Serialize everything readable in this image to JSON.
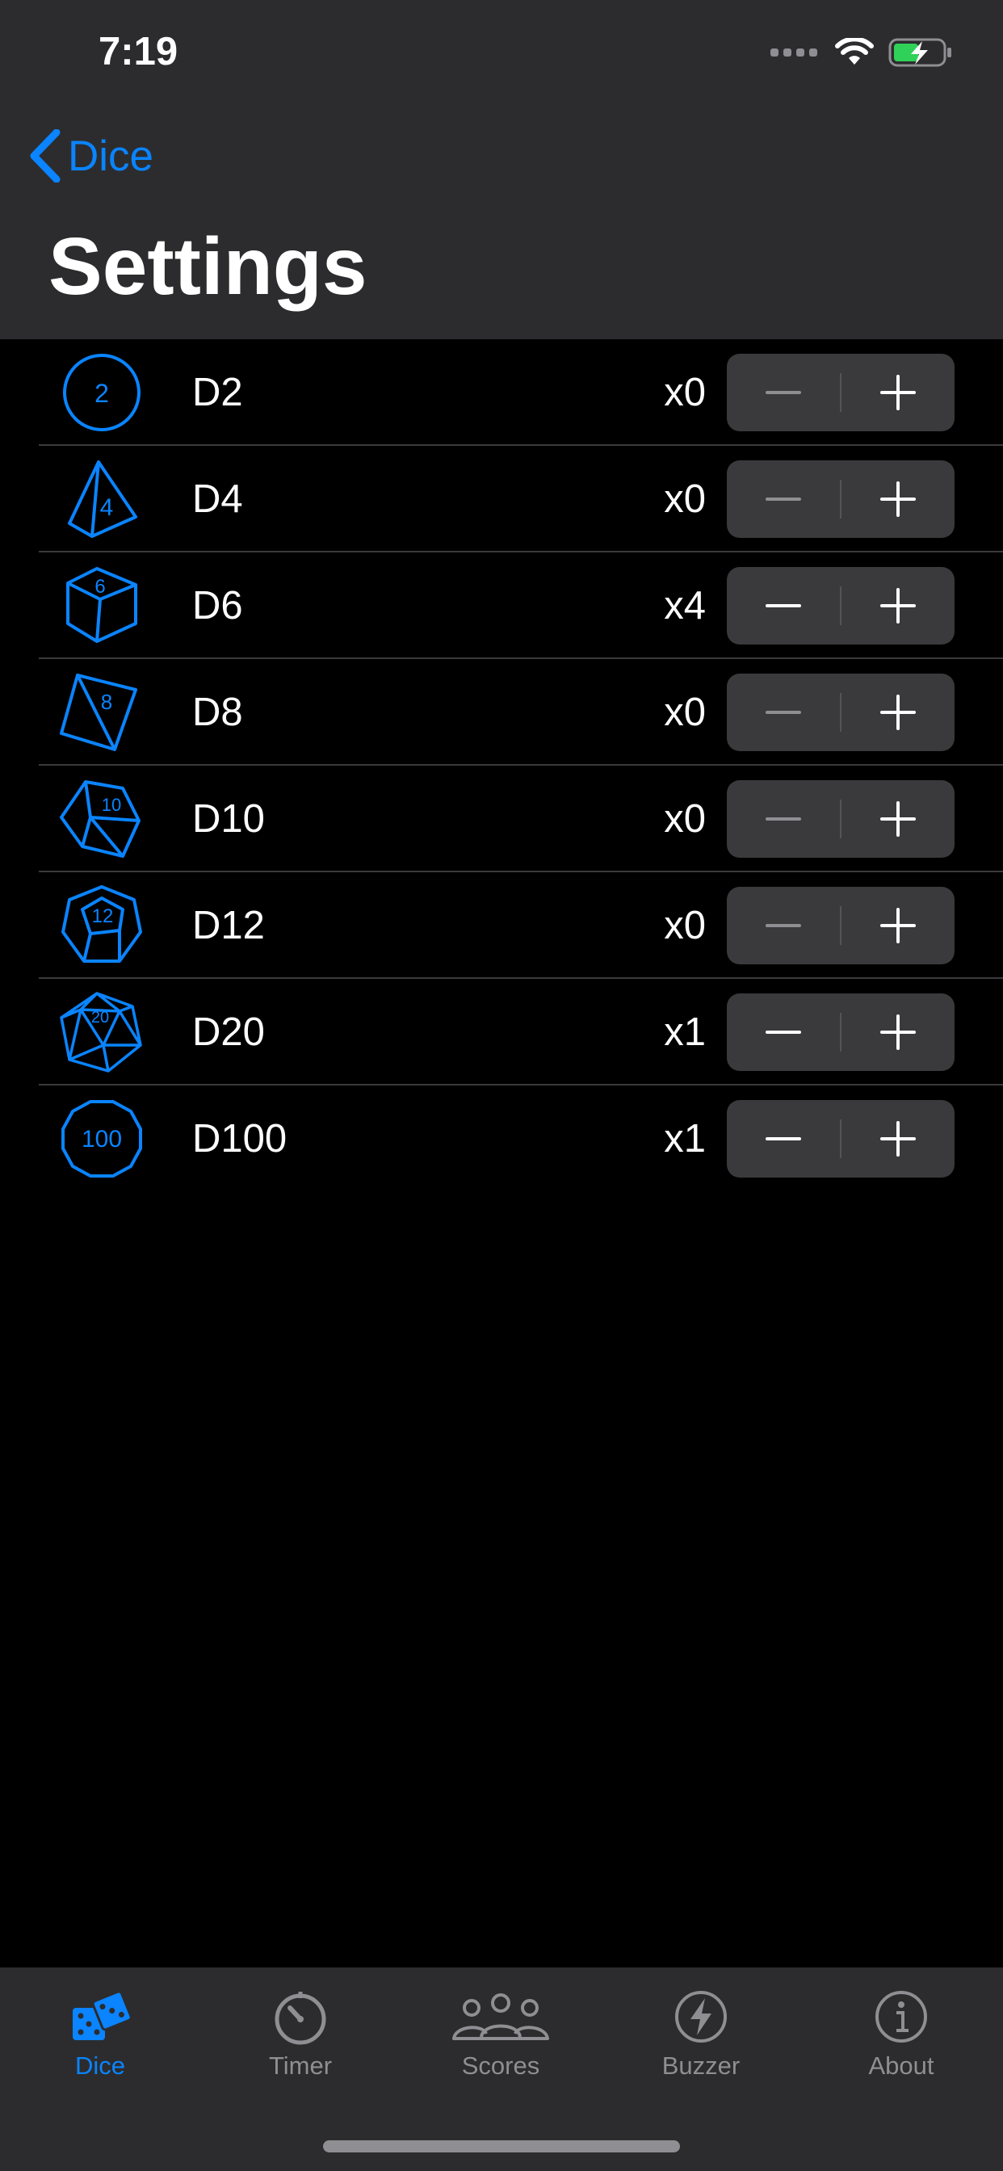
{
  "status": {
    "time": "7:19"
  },
  "nav": {
    "back_label": "Dice",
    "title": "Settings"
  },
  "dice": [
    {
      "label": "D2",
      "count": "x0",
      "icon": "d2-circle-icon",
      "face": "2",
      "can_decrement": false
    },
    {
      "label": "D4",
      "count": "x0",
      "icon": "d4-tetrahedron-icon",
      "face": "4",
      "can_decrement": false
    },
    {
      "label": "D6",
      "count": "x4",
      "icon": "d6-cube-icon",
      "face": "6",
      "can_decrement": true
    },
    {
      "label": "D8",
      "count": "x0",
      "icon": "d8-octahedron-icon",
      "face": "8",
      "can_decrement": false
    },
    {
      "label": "D10",
      "count": "x0",
      "icon": "d10-icon",
      "face": "10",
      "can_decrement": false
    },
    {
      "label": "D12",
      "count": "x0",
      "icon": "d12-dodecahedron-icon",
      "face": "12",
      "can_decrement": false
    },
    {
      "label": "D20",
      "count": "x1",
      "icon": "d20-icosahedron-icon",
      "face": "20",
      "can_decrement": true
    },
    {
      "label": "D100",
      "count": "x1",
      "icon": "d100-icon",
      "face": "100",
      "can_decrement": true
    }
  ],
  "tabs": [
    {
      "label": "Dice",
      "icon": "dice-icon",
      "active": true
    },
    {
      "label": "Timer",
      "icon": "timer-icon",
      "active": false
    },
    {
      "label": "Scores",
      "icon": "people-icon",
      "active": false
    },
    {
      "label": "Buzzer",
      "icon": "bolt-icon",
      "active": false
    },
    {
      "label": "About",
      "icon": "info-icon",
      "active": false
    }
  ],
  "colors": {
    "accent": "#0a84ff",
    "bar": "#2c2c2e",
    "background": "#000000",
    "battery_charge": "#30d158"
  }
}
